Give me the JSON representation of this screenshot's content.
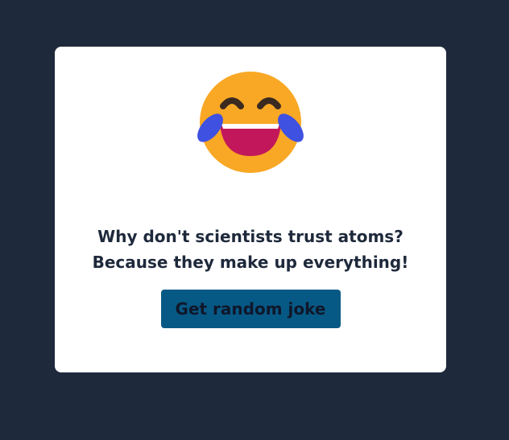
{
  "card": {
    "icon": "tears-of-joy-emoji-icon",
    "joke_text": "Why don't scientists trust atoms? Because they make up everything!",
    "button_label": "Get random joke"
  },
  "colors": {
    "background": "#1e293b",
    "card": "#ffffff",
    "button": "#075985",
    "text": "#1e293b"
  }
}
